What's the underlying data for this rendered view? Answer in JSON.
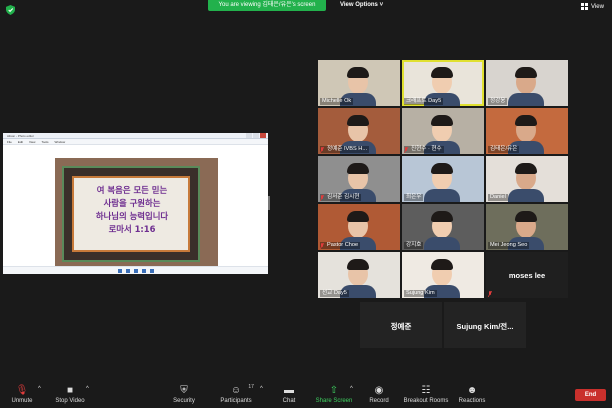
{
  "top": {
    "viewing_banner": "You are viewing 김태은/유은's screen",
    "view_options": "View Options ˅",
    "view_label": "View",
    "security_color": "#22b14c"
  },
  "share": {
    "window_title": "Alison - Photo editor",
    "menu_items": [
      "File",
      "Edit",
      "View",
      "Tools",
      "Window"
    ],
    "verse_lines": [
      "여 복음은 모든 믿는",
      "사람을 구원하는",
      "하나님의 능력입니다",
      "로마서 1:16"
    ]
  },
  "gallery": [
    {
      "name": "Michelle Ok",
      "muted": false,
      "active": false,
      "bg": "#cfc7b6"
    },
    {
      "name": "크래프트 Day5",
      "muted": false,
      "active": true,
      "bg": "#e9e4da"
    },
    {
      "name": "정강웅",
      "muted": false,
      "active": false,
      "bg": "#d8d4cf"
    },
    {
      "name": "정예준 IVBS H...",
      "muted": true,
      "active": false,
      "bg": "#a45c3c"
    },
    {
      "name": "진현수 · 현수",
      "muted": true,
      "active": false,
      "bg": "#b7b0a4"
    },
    {
      "name": "김태은/유은",
      "muted": false,
      "active": false,
      "bg": "#c46a3e"
    },
    {
      "name": "김서준 김시현",
      "muted": true,
      "active": false,
      "bg": "#8f8f8f"
    },
    {
      "name": "최은우",
      "muted": false,
      "active": false,
      "bg": "#b8c6d6"
    },
    {
      "name": "Daniel",
      "muted": false,
      "active": false,
      "bg": "#e4dfd9"
    },
    {
      "name": "Pastor Choe",
      "muted": true,
      "active": false,
      "bg": "#b05a35"
    },
    {
      "name": "강지호",
      "muted": false,
      "active": false,
      "bg": "#5d5d5d"
    },
    {
      "name": "Mei Jeong Seo",
      "muted": false,
      "active": false,
      "bg": "#6e6e5c"
    },
    {
      "name": "선교 Day5",
      "muted": false,
      "active": false,
      "bg": "#e5e2dc"
    },
    {
      "name": "Sujung Kim",
      "muted": false,
      "active": false,
      "bg": "#efeae3"
    },
    {
      "name": "moses lee",
      "muted": true,
      "active": false,
      "bg": "#1f1f1f",
      "video_off": true
    }
  ],
  "bottom_tiles": [
    "정예준",
    "Sujung Kim/전..."
  ],
  "toolbar": {
    "items": [
      {
        "label": "Unmute",
        "icon": "mic-muted-icon",
        "caret": true
      },
      {
        "label": "Stop Video",
        "icon": "video-icon",
        "caret": true
      },
      {
        "label": "Security",
        "icon": "shield-icon",
        "caret": false
      },
      {
        "label": "Participants",
        "icon": "participants-icon",
        "caret": true,
        "count": "17"
      },
      {
        "label": "Chat",
        "icon": "chat-icon",
        "caret": false
      },
      {
        "label": "Share Screen",
        "icon": "share-screen-icon",
        "caret": true
      },
      {
        "label": "Record",
        "icon": "record-icon",
        "caret": false
      },
      {
        "label": "Breakout Rooms",
        "icon": "breakout-rooms-icon",
        "caret": false
      },
      {
        "label": "Reactions",
        "icon": "reactions-icon",
        "caret": false
      }
    ],
    "end_label": "End",
    "end_color": "#c9302c",
    "share_color": "#3ed160"
  }
}
